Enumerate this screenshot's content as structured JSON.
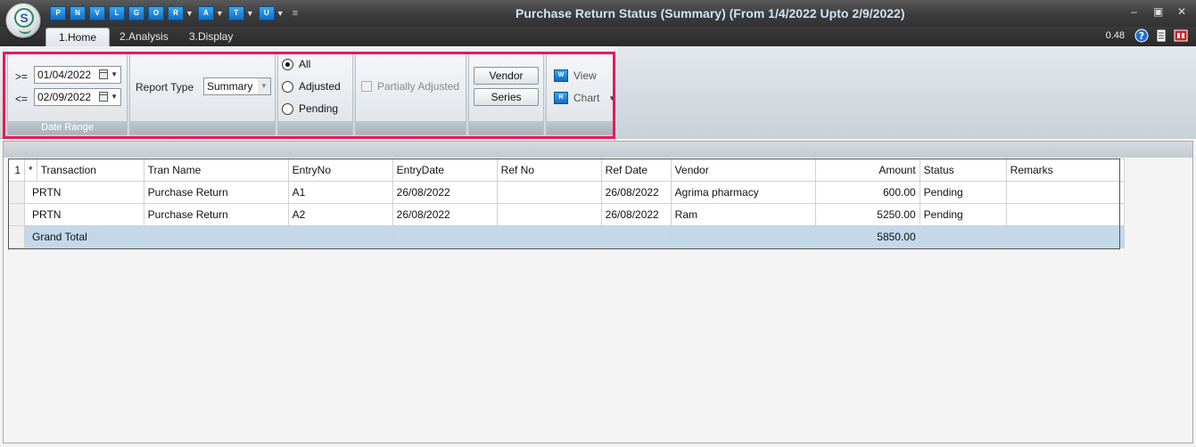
{
  "window": {
    "title": "Purchase Return Status (Summary)  (From 1/4/2022 Upto 2/9/2022)",
    "logo_letter": "S"
  },
  "quick_access": [
    {
      "label": "P"
    },
    {
      "label": "N"
    },
    {
      "label": "V"
    },
    {
      "label": "L"
    },
    {
      "label": "G"
    },
    {
      "label": "O"
    },
    {
      "label": "R"
    },
    {
      "label": "A"
    },
    {
      "label": "T"
    },
    {
      "label": "U"
    }
  ],
  "tabs": [
    {
      "label": "1.Home",
      "active": true
    },
    {
      "label": "2.Analysis",
      "active": false
    },
    {
      "label": "3.Display",
      "active": false
    }
  ],
  "status": {
    "zoom": "0.48"
  },
  "ribbon": {
    "date_range": {
      "caption": "Date Range",
      "from_label": ">=",
      "from_value": "01/04/2022",
      "to_label": "<=",
      "to_value": "02/09/2022"
    },
    "report_type": {
      "label": "Report Type",
      "value": "Summary"
    },
    "filter": {
      "options": [
        "All",
        "Adjusted",
        "Pending"
      ],
      "selected": "All"
    },
    "partially_adjusted": {
      "label": "Partially Adjusted",
      "checked": false
    },
    "buttons": {
      "vendor": "Vendor",
      "series": "Series"
    },
    "view": {
      "view_label": "View",
      "chart_label": "Chart"
    }
  },
  "grid": {
    "corner": [
      "1",
      "*"
    ],
    "columns": [
      "Transaction",
      "Tran Name",
      "EntryNo",
      "EntryDate",
      "Ref No",
      "Ref Date",
      "Vendor",
      "Amount",
      "Status",
      "Remarks"
    ],
    "rows": [
      {
        "transaction": "PRTN",
        "tran_name": "Purchase Return",
        "entry_no": "A1",
        "entry_date": "26/08/2022",
        "ref_no": "",
        "ref_date": "26/08/2022",
        "vendor": "Agrima pharmacy",
        "amount": "600.00",
        "status": "Pending",
        "remarks": ""
      },
      {
        "transaction": "PRTN",
        "tran_name": "Purchase Return",
        "entry_no": "A2",
        "entry_date": "26/08/2022",
        "ref_no": "",
        "ref_date": "26/08/2022",
        "vendor": "Ram",
        "amount": "5250.00",
        "status": "Pending",
        "remarks": ""
      }
    ],
    "total": {
      "label": "Grand Total",
      "amount": "5850.00"
    }
  },
  "colors": {
    "highlight": "#e8185a",
    "title_text": "#cfe3f5",
    "total_row": "#c4d8ea",
    "icon_blue": "#0f6fc6"
  }
}
